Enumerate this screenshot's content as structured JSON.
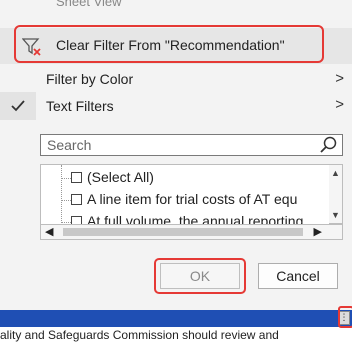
{
  "menu": {
    "sheet_view_label": "Sheet View",
    "clear_filter_label": "Clear Filter From \"Recommendation\"",
    "filter_by_color_label": "Filter by Color",
    "text_filters_label": "Text Filters",
    "submenu_arrow": ">"
  },
  "search": {
    "placeholder": "Search"
  },
  "list": {
    "items": [
      {
        "label": "(Select All)"
      },
      {
        "label": "A line item for trial costs of AT equ"
      },
      {
        "label": "At full volume, the annual reporting"
      }
    ]
  },
  "buttons": {
    "ok": "OK",
    "cancel": "Cancel"
  },
  "sheet": {
    "cell_text": "ality and Safeguards Commission should review and"
  },
  "colors": {
    "highlight": "#e53935",
    "bar": "#1f4fb4"
  }
}
